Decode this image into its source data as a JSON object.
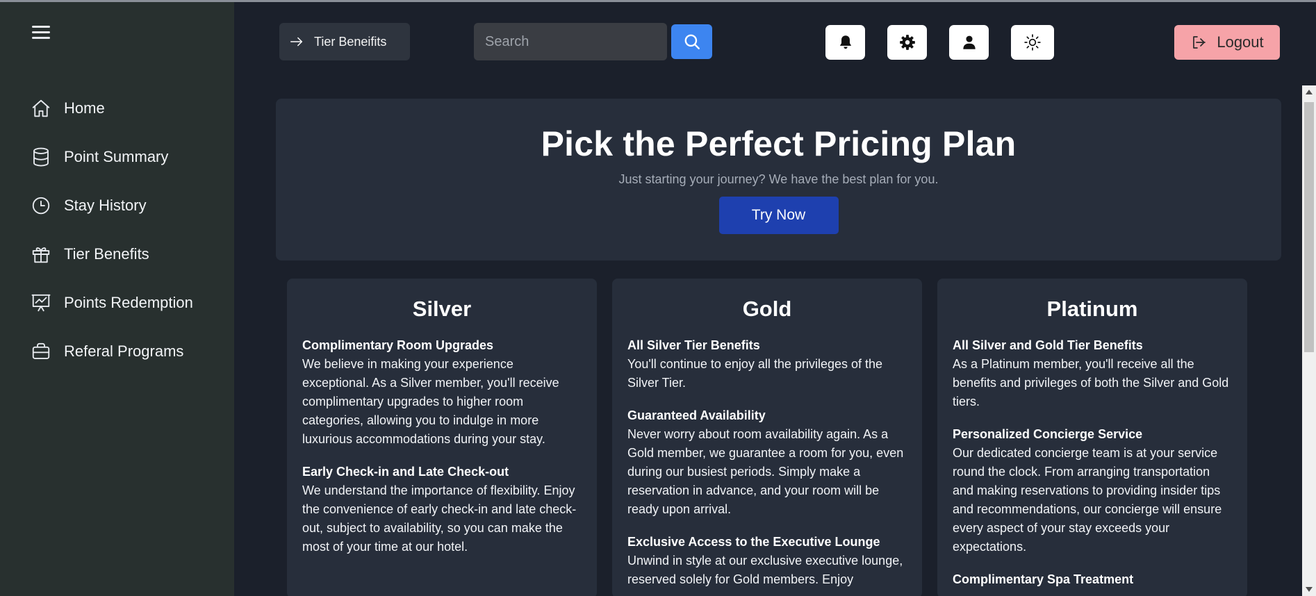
{
  "sidebar": {
    "items": [
      {
        "label": "Home",
        "icon": "home-icon"
      },
      {
        "label": "Point Summary",
        "icon": "database-icon"
      },
      {
        "label": "Stay History",
        "icon": "clock-icon"
      },
      {
        "label": "Tier Benefits",
        "icon": "gift-icon"
      },
      {
        "label": "Points Redemption",
        "icon": "presentation-chart-icon"
      },
      {
        "label": "Referal Programs",
        "icon": "briefcase-icon"
      }
    ]
  },
  "header": {
    "breadcrumb": "Tier Beneifits",
    "search_placeholder": "Search",
    "logout_label": "Logout"
  },
  "hero": {
    "title": "Pick the Perfect Pricing Plan",
    "subtitle": "Just starting your journey? We have the best plan for you.",
    "cta": "Try Now"
  },
  "tiers": [
    {
      "name": "Silver",
      "benefits": [
        {
          "title": "Complimentary Room Upgrades",
          "desc": "We believe in making your experience exceptional. As a Silver member, you'll receive complimentary upgrades to higher room categories, allowing you to indulge in more luxurious accommodations during your stay."
        },
        {
          "title": "Early Check-in and Late Check-out",
          "desc": "We understand the importance of flexibility. Enjoy the convenience of early check-in and late check-out, subject to availability, so you can make the most of your time at our hotel."
        }
      ]
    },
    {
      "name": "Gold",
      "benefits": [
        {
          "title": "All Silver Tier Benefits",
          "desc": "You'll continue to enjoy all the privileges of the Silver Tier."
        },
        {
          "title": "Guaranteed Availability",
          "desc": "Never worry about room availability again. As a Gold member, we guarantee a room for you, even during our busiest periods. Simply make a reservation in advance, and your room will be ready upon arrival."
        },
        {
          "title": "Exclusive Access to the Executive Lounge",
          "desc": "Unwind in style at our exclusive executive lounge, reserved solely for Gold members. Enjoy"
        }
      ]
    },
    {
      "name": "Platinum",
      "benefits": [
        {
          "title": "All Silver and Gold Tier Benefits",
          "desc": "As a Platinum member, you'll receive all the benefits and privileges of both the Silver and Gold tiers."
        },
        {
          "title": "Personalized Concierge Service",
          "desc": "Our dedicated concierge team is at your service round the clock. From arranging transportation and making reservations to providing insider tips and recommendations, our concierge will ensure every aspect of your stay exceeds your expectations."
        },
        {
          "title": "Complimentary Spa Treatment",
          "desc": ""
        }
      ]
    }
  ],
  "colors": {
    "sidebar_bg": "#28302f",
    "main_bg": "#1b202b",
    "card_bg": "#272e3b",
    "accent_blue": "#3d85f0",
    "cta_blue": "#1e40af",
    "logout_pink": "#f6a3a8"
  }
}
